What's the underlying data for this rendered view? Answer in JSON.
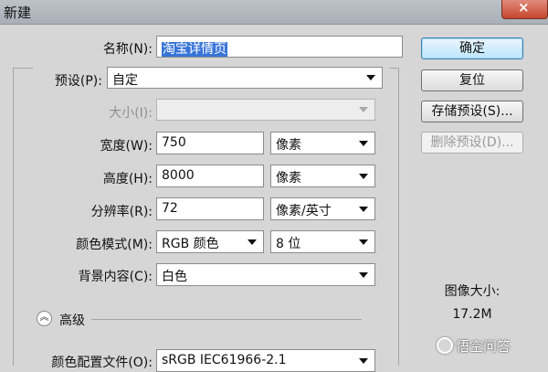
{
  "window": {
    "title": "新建"
  },
  "form": {
    "name": {
      "label": "名称(N):",
      "value": "淘宝详情页"
    },
    "preset": {
      "label": "预设(P):",
      "value": "自定"
    },
    "size": {
      "label": "大小(I):",
      "value": ""
    },
    "width": {
      "label": "宽度(W):",
      "value": "750",
      "unit": "像素"
    },
    "height": {
      "label": "高度(H):",
      "value": "8000",
      "unit": "像素"
    },
    "resolution": {
      "label": "分辨率(R):",
      "value": "72",
      "unit": "像素/英寸"
    },
    "color_mode": {
      "label": "颜色模式(M):",
      "value": "RGB 颜色",
      "depth": "8 位"
    },
    "background": {
      "label": "背景内容(C):",
      "value": "白色"
    },
    "advanced": {
      "label": "高级",
      "icon": "collapse-chevron-icon"
    },
    "color_profile": {
      "label": "颜色配置文件(O):",
      "value": "sRGB IEC61966-2.1"
    }
  },
  "buttons": {
    "ok": "确定",
    "reset": "复位",
    "save_preset": "存储预设(S)...",
    "delete_preset": "删除预设(D)..."
  },
  "image_size": {
    "label": "图像大小:",
    "value": "17.2M"
  },
  "watermark": {
    "text": "悟空问答",
    "icon": "wukong-logo-icon"
  },
  "colors": {
    "highlight": "#3875d7",
    "close_button": "#c6462f"
  }
}
